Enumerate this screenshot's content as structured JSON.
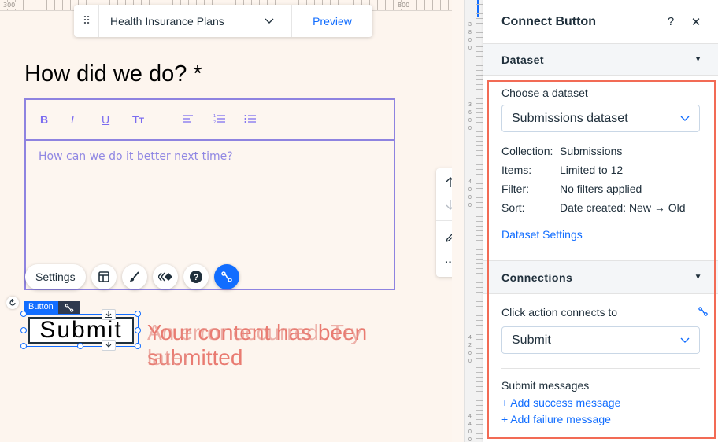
{
  "canvas": {
    "ruler_labels": [
      "300",
      "800"
    ],
    "page_selector": "Health Insurance Plans",
    "preview_label": "Preview",
    "question_title": "How did we do? *",
    "rte_placeholder": "How can we do it better next time?",
    "rte_tools": [
      "B",
      "I",
      "U",
      "Tт"
    ],
    "float_toolbar_settings": "Settings",
    "selection_tag": "Button",
    "submit_button": "Submit",
    "message_a": "Your content has been submitted",
    "message_b": "An error occurred. Try later"
  },
  "ruler_right_numbers": [
    "3",
    "8",
    "0",
    "0",
    "3",
    "6",
    "0",
    "0",
    "4",
    "0",
    "0",
    "0",
    "4",
    "2",
    "0",
    "0",
    "4",
    "4",
    "0",
    "0"
  ],
  "panel": {
    "title": "Connect Button",
    "help": "?",
    "close": "✕",
    "dataset_section": "Dataset",
    "choose_label": "Choose a dataset",
    "dataset_value": "Submissions dataset",
    "info": [
      {
        "key": "Collection:",
        "value": "Submissions"
      },
      {
        "key": "Items:",
        "value": "Limited to 12"
      },
      {
        "key": "Filter:",
        "value": "No filters applied"
      },
      {
        "key": "Sort:",
        "value": "Date created: New → Old"
      }
    ],
    "dataset_settings": "Dataset Settings",
    "connections_section": "Connections",
    "click_action_label": "Click action connects to",
    "click_action_value": "Submit",
    "submit_messages_label": "Submit messages",
    "add_success": "+ Add success message",
    "add_failure": "+ Add failure message"
  },
  "colors": {
    "accent": "#116dff",
    "highlight": "#f26b55",
    "rte_border": "#8e83e0"
  }
}
